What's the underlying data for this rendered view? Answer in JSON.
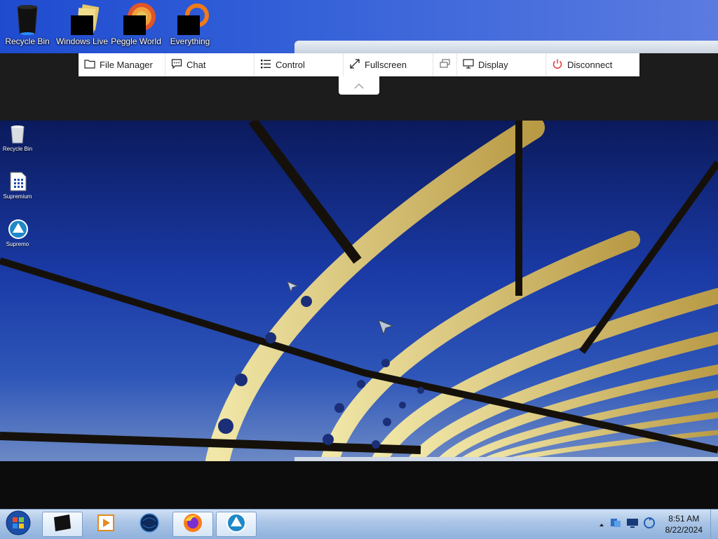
{
  "host_desktop": {
    "icons": [
      {
        "label": "Recycle Bin",
        "icon": "recycle-bin-icon"
      },
      {
        "label": "Windows Live",
        "icon": "windows-live-icon"
      },
      {
        "label": "Peggle World",
        "icon": "peggle-world-icon"
      },
      {
        "label": "Everything",
        "icon": "everything-icon"
      }
    ]
  },
  "toolbar": {
    "items": [
      {
        "label": "File Manager",
        "icon": "folder-icon"
      },
      {
        "label": "Chat",
        "icon": "chat-icon"
      },
      {
        "label": "Control",
        "icon": "list-icon"
      },
      {
        "label": "Fullscreen",
        "icon": "expand-icon"
      },
      {
        "label": "",
        "icon": "switch-monitor-icon"
      },
      {
        "label": "Display",
        "icon": "monitor-icon"
      },
      {
        "label": "Disconnect",
        "icon": "power-icon"
      }
    ],
    "collapse_icon": "chevron-up-icon",
    "colors": {
      "disconnect": "#e53935"
    }
  },
  "remote_desktop": {
    "icons": [
      {
        "label": "Recycle Bin",
        "icon": "recycle-bin-icon"
      },
      {
        "label": "Supremium",
        "icon": "calculator-icon"
      },
      {
        "label": "Supremo",
        "icon": "supremo-icon"
      }
    ]
  },
  "taskbar": {
    "start_icon": "windows-start-icon",
    "apps": [
      {
        "icon": "black-window-icon",
        "active": true
      },
      {
        "icon": "media-player-icon",
        "active": false
      },
      {
        "icon": "globe-icon",
        "active": false
      },
      {
        "icon": "firefox-icon",
        "active": true
      },
      {
        "icon": "supremo-icon",
        "active": true
      }
    ],
    "tray_icons": [
      "chevron-up-icon",
      "network-icon",
      "monitor-icon",
      "sync-icon"
    ],
    "clock": {
      "time": "8:51 AM",
      "date": "8/22/2024"
    }
  }
}
